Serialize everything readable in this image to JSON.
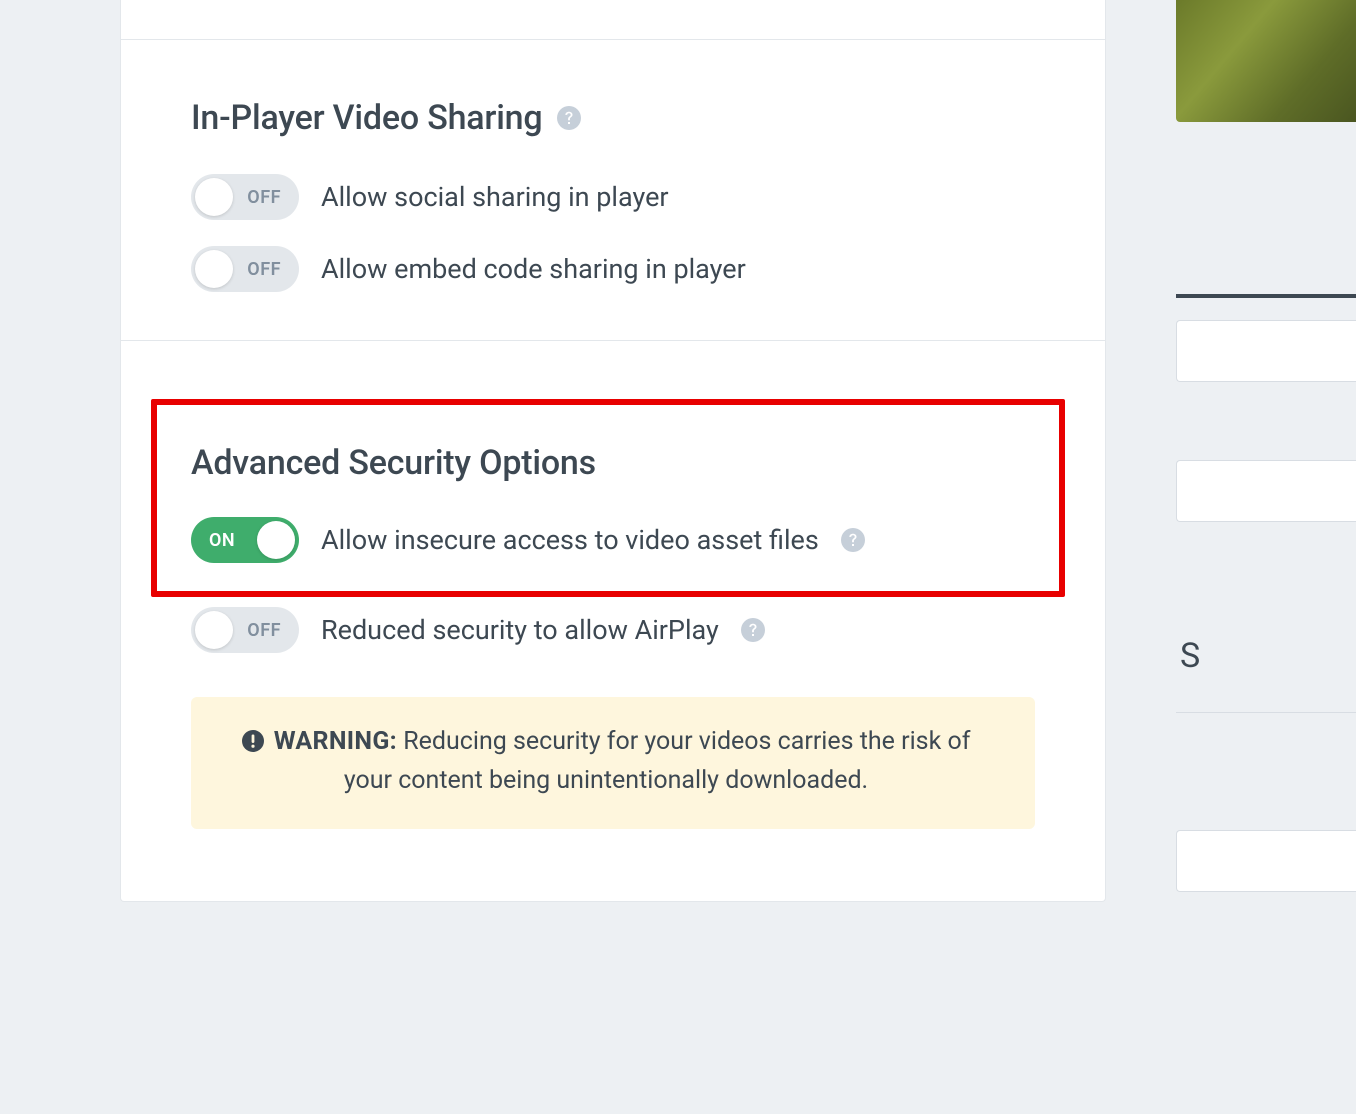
{
  "sections": {
    "sharing": {
      "title": "In-Player Video Sharing",
      "toggles": [
        {
          "state": "off",
          "stateText": "OFF",
          "label": "Allow social sharing in player"
        },
        {
          "state": "off",
          "stateText": "OFF",
          "label": "Allow embed code sharing in player"
        }
      ]
    },
    "security": {
      "title": "Advanced Security Options",
      "toggles": [
        {
          "state": "on",
          "stateText": "ON",
          "label": "Allow insecure access to video asset files",
          "help": true
        },
        {
          "state": "off",
          "stateText": "OFF",
          "label": "Reduced security to allow AirPlay",
          "help": true
        }
      ],
      "warning": {
        "label": "WARNING:",
        "text": "Reducing security for your videos carries the risk of your content being unintentionally downloaded."
      }
    }
  },
  "rightStrip": {
    "text": "S"
  }
}
